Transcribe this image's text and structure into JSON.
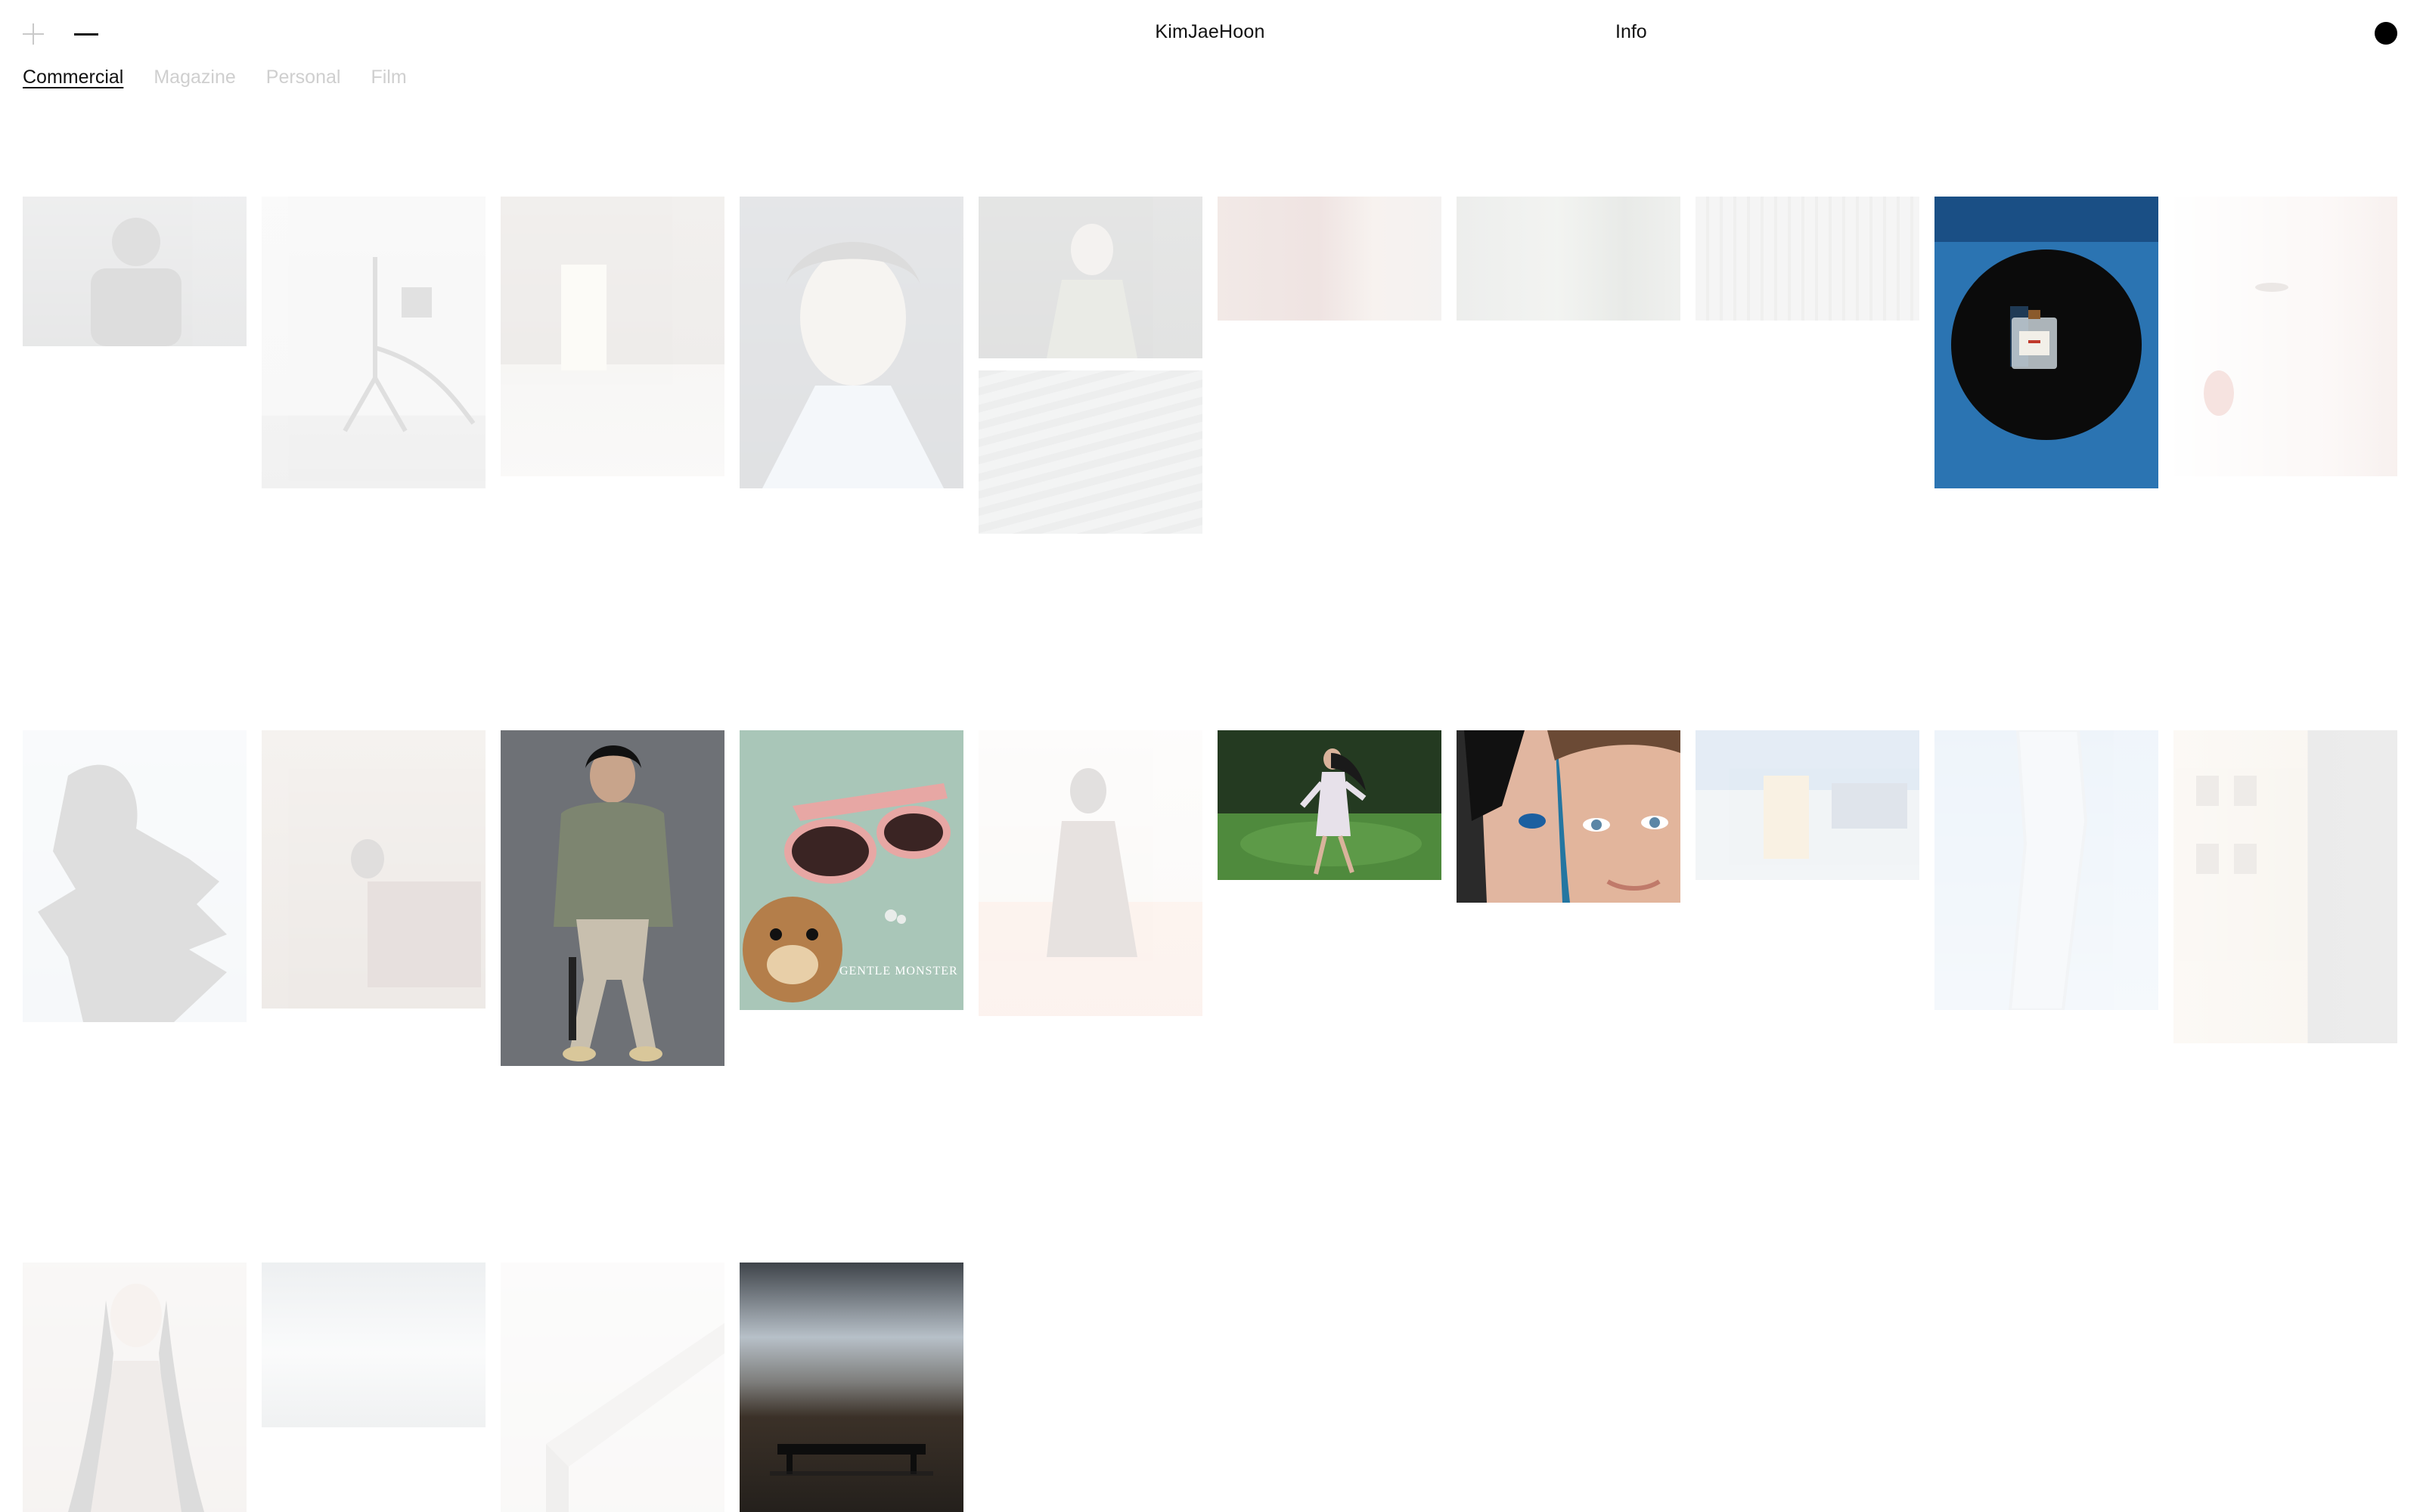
{
  "header": {
    "title": "KimJaeHoon",
    "info_label": "Info"
  },
  "tabs": [
    {
      "label": "Commercial",
      "active": true
    },
    {
      "label": "Magazine",
      "active": false
    },
    {
      "label": "Personal",
      "active": false
    },
    {
      "label": "Film",
      "active": false
    }
  ],
  "gallery": {
    "sunglasses_brand_text": "GENTLE MONSTER"
  }
}
